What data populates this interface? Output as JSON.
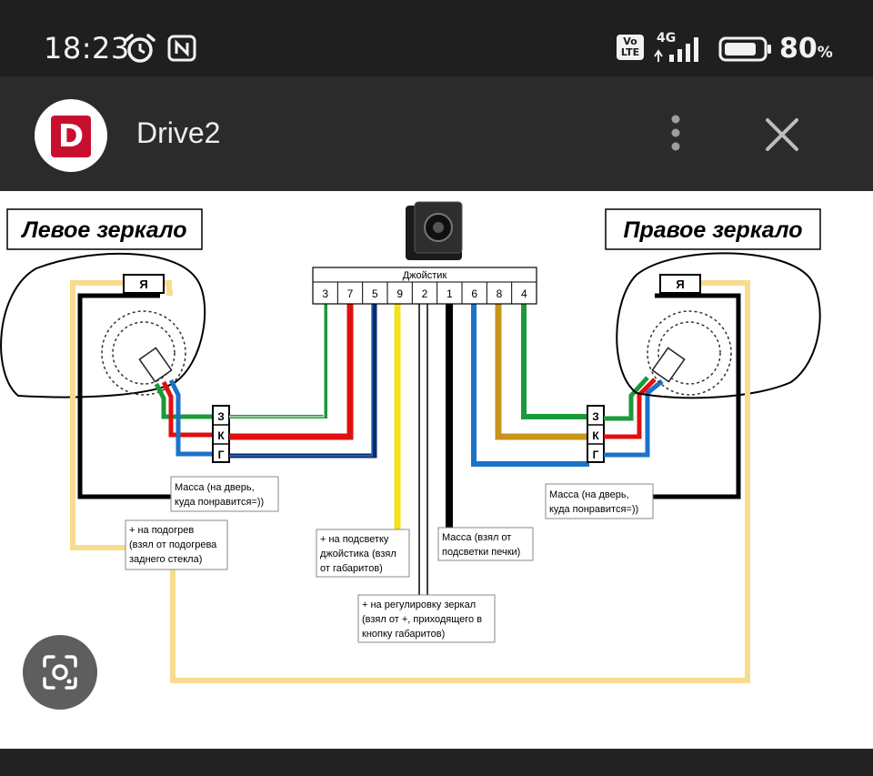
{
  "status_bar": {
    "time": "18:23",
    "battery_percent": "80",
    "battery_unit": "%",
    "network": "4G",
    "volte_top": "Vo",
    "volte_bottom": "LTE"
  },
  "app_bar": {
    "logo_letter": "D",
    "title": "Drive2"
  },
  "diagram": {
    "left_mirror_title": "Левое зеркало",
    "right_mirror_title": "Правое зеркало",
    "joystick_label": "Джойстик",
    "pins": [
      "3",
      "7",
      "5",
      "9",
      "2",
      "1",
      "6",
      "8",
      "4"
    ],
    "connector_left": {
      "top": "Я",
      "pins": [
        "З",
        "К",
        "Г"
      ]
    },
    "connector_right": {
      "top": "Я",
      "pins": [
        "З",
        "К",
        "Г"
      ]
    },
    "notes": {
      "left_ground": [
        "Масса (на дверь,",
        "куда понравится=))"
      ],
      "right_ground": [
        "Масса (на дверь,",
        "куда понравится=))"
      ],
      "heating": [
        "+ на подогрев",
        "(взял от подогрева",
        "заднего стекла)"
      ],
      "backlight": [
        "+ на подсветку",
        "джойстика (взял",
        "от габаритов)"
      ],
      "ground_center": [
        "Масса (взял от",
        "подсветки печки)"
      ],
      "adjust": [
        "+ на регулировку зеркал",
        "(взял от +, приходящего в",
        "кнопку габаритов)"
      ]
    },
    "wire_colors": {
      "green": "#1a9a3a",
      "red": "#e01010",
      "blue": "#1a73c8",
      "navy": "#0e2a6b",
      "yellow": "#f5e11a",
      "black": "#000000",
      "gold": "#c8951a",
      "cream": "#f7dc8f"
    }
  }
}
